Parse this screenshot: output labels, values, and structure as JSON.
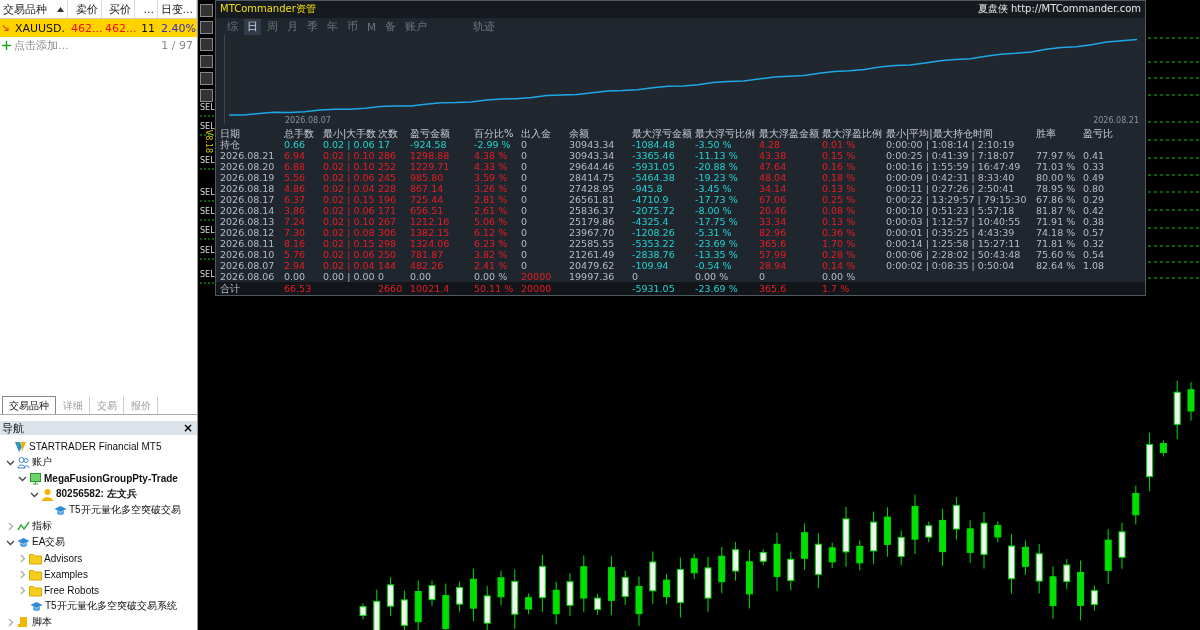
{
  "market_watch": {
    "columns": [
      "交易品种",
      "卖价",
      "买价",
      "...",
      "日变..."
    ],
    "rows": [
      {
        "selected": true,
        "cells": [
          "XAUUSD.",
          "462...",
          "462...",
          "11",
          "2.40%"
        ]
      }
    ],
    "add_label": "点击添加...",
    "count": "1 / 97"
  },
  "bottom_tabs": [
    {
      "label": "交易品种",
      "selected": true
    },
    {
      "label": "详细",
      "selected": false
    },
    {
      "label": "交易",
      "selected": false
    },
    {
      "label": "报价",
      "selected": false
    }
  ],
  "navigator": {
    "title": "导航",
    "close": "×",
    "tree": [
      {
        "label": "STARTRADER Financial MT5",
        "kind": "broker",
        "bold": false,
        "children": [
          {
            "label": "账户",
            "kind": "accounts",
            "bold": false,
            "expanded": true,
            "children": [
              {
                "label": "MegaFusionGroupPty-Trade",
                "kind": "server",
                "bold": true,
                "expanded": true,
                "children": [
                  {
                    "label": "80256582: 左文兵",
                    "kind": "user",
                    "bold": true,
                    "expanded": true,
                    "children": [
                      {
                        "label": "T5开元量化多空突破交易",
                        "kind": "ea",
                        "bold": false
                      }
                    ]
                  }
                ]
              }
            ]
          },
          {
            "label": "指标",
            "kind": "indicator",
            "bold": false,
            "expanded": false
          },
          {
            "label": "EA交易",
            "kind": "ea",
            "bold": false,
            "expanded": true,
            "children": [
              {
                "label": "Advisors",
                "kind": "folder",
                "bold": false,
                "expanded": false
              },
              {
                "label": "Examples",
                "kind": "folder",
                "bold": false,
                "expanded": false
              },
              {
                "label": "Free Robots",
                "kind": "folder",
                "bold": false,
                "expanded": false
              },
              {
                "label": "T5开元量化多空突破交易系统",
                "kind": "ea",
                "bold": false
              }
            ]
          },
          {
            "label": "脚本",
            "kind": "script",
            "bold": false,
            "expanded": false
          }
        ]
      }
    ]
  },
  "chart_side": {
    "version": "V8.18",
    "labels": [
      "SEL",
      "SEL",
      "SEL",
      "SEL",
      "SEL",
      "SEL",
      "SEL",
      "SEL"
    ]
  },
  "panel": {
    "title": "MTCommander资管",
    "brand": "夏盘侠 http://MTCommander.com",
    "tab_groups": [
      [
        {
          "label": "综",
          "selected": false
        },
        {
          "label": "日",
          "selected": true
        },
        {
          "label": "周",
          "selected": false
        },
        {
          "label": "月",
          "selected": false
        },
        {
          "label": "季",
          "selected": false
        },
        {
          "label": "年",
          "selected": false
        },
        {
          "label": "币",
          "selected": false
        },
        {
          "label": "M",
          "selected": false
        },
        {
          "label": "备",
          "selected": false
        },
        {
          "label": "账户",
          "selected": false
        }
      ],
      [
        {
          "label": "轨迹",
          "selected": false
        }
      ]
    ],
    "curve": {
      "start_date": "2026.08.07",
      "end_date": "2026.08.21"
    },
    "table": {
      "columns": [
        "日期",
        "总手数",
        "最小|大手数",
        "次数",
        "盈亏金额",
        "百分比%",
        "出入金",
        "余额",
        "最大浮亏金额",
        "最大浮亏比例",
        "最大浮盈金额",
        "最大浮盈比例",
        "最小|平均|最大持仓时间",
        "胜率",
        "盈亏比"
      ],
      "rows": [
        {
          "kind": "position",
          "cells": [
            "持仓",
            "0.66",
            "0.02 | 0.06",
            "17",
            "-924.58",
            "-2.99 %",
            "0",
            "30943.34",
            "-1084.48",
            "-3.50 %",
            "4.28",
            "0.01 %",
            "0:00:00 | 1:08:14 | 2:10:19",
            null,
            null
          ]
        },
        {
          "kind": "day",
          "cells": [
            "2026.08.21",
            "6.94",
            "0.02 | 0.10",
            "286",
            "1298.88",
            "4.38 %",
            "0",
            "30943.34",
            "-3365.46",
            "-11.13 %",
            "43.38",
            "0.15 %",
            "0:00:25 | 0:41:39 | 7:18:07",
            "77.97 %",
            "0.41"
          ]
        },
        {
          "kind": "day",
          "cells": [
            "2026.08.20",
            "6.88",
            "0.02 | 0.10",
            "252",
            "1229.71",
            "4.33 %",
            "0",
            "29644.46",
            "-5931.05",
            "-20.88 %",
            "47.64",
            "0.16 %",
            "0:00:16 | 1:55:59 | 16:47:49",
            "71.03 %",
            "0.33"
          ]
        },
        {
          "kind": "day",
          "cells": [
            "2026.08.19",
            "5.56",
            "0.02 | 0.06",
            "245",
            "985.80",
            "3.59 %",
            "0",
            "28414.75",
            "-5464.38",
            "-19.23 %",
            "48.04",
            "0.18 %",
            "0:00:09 | 0:42:31 | 8:33:40",
            "80.00 %",
            "0.49"
          ]
        },
        {
          "kind": "day",
          "cells": [
            "2026.08.18",
            "4.86",
            "0.02 | 0.04",
            "228",
            "867.14",
            "3.26 %",
            "0",
            "27428.95",
            "-945.8",
            "-3.45 %",
            "34.14",
            "0.13 %",
            "0:00:11 | 0:27:26 | 2:50:41",
            "78.95 %",
            "0.80"
          ]
        },
        {
          "kind": "day",
          "cells": [
            "2026.08.17",
            "6.37",
            "0.02 | 0.15",
            "196",
            "725.44",
            "2.81 %",
            "0",
            "26561.81",
            "-4710.9",
            "-17.73 %",
            "67.06",
            "0.25 %",
            "0:00:22 | 13:29:57 | 79:15:30",
            "67.86 %",
            "0.29"
          ]
        },
        {
          "kind": "day",
          "cells": [
            "2026.08.14",
            "3.86",
            "0.02 | 0.06",
            "171",
            "656.51",
            "2.61 %",
            "0",
            "25836.37",
            "-2075.72",
            "-8.00 %",
            "20.46",
            "0.08 %",
            "0:00:10 | 0:51:23 | 5:57:18",
            "81.87 %",
            "0.42"
          ]
        },
        {
          "kind": "day",
          "cells": [
            "2026.08.13",
            "7.24",
            "0.02 | 0.10",
            "267",
            "1212.16",
            "5.06 %",
            "0",
            "25179.86",
            "-4325.4",
            "-17.75 %",
            "33.34",
            "0.13 %",
            "0:00:03 | 1:12:57 | 10:40:55",
            "71.91 %",
            "0.38"
          ]
        },
        {
          "kind": "day",
          "cells": [
            "2026.08.12",
            "7.30",
            "0.02 | 0.08",
            "306",
            "1382.15",
            "6.12 %",
            "0",
            "23967.70",
            "-1208.26",
            "-5.31 %",
            "82.96",
            "0.36 %",
            "0:00:01 | 0:35:25 | 4:43:39",
            "74.18 %",
            "0.57"
          ]
        },
        {
          "kind": "day",
          "cells": [
            "2026.08.11",
            "8.16",
            "0.02 | 0.15",
            "298",
            "1324.06",
            "6.23 %",
            "0",
            "22585.55",
            "-5353.22",
            "-23.69 %",
            "365.6",
            "1.70 %",
            "0:00:14 | 1:25:58 | 15:27:11",
            "71.81 %",
            "0.32"
          ]
        },
        {
          "kind": "day",
          "cells": [
            "2026.08.10",
            "5.76",
            "0.02 | 0.06",
            "250",
            "781.87",
            "3.82 %",
            "0",
            "21261.49",
            "-2838.76",
            "-13.35 %",
            "57.99",
            "0.28 %",
            "0:00:06 | 2:28:02 | 50:43:48",
            "75.60 %",
            "0.54"
          ]
        },
        {
          "kind": "day",
          "cells": [
            "2026.08.07",
            "2.94",
            "0.02 | 0.04",
            "144",
            "482.26",
            "2.41 %",
            "0",
            "20479.62",
            "-109.94",
            "-0.54 %",
            "28.94",
            "0.14 %",
            "0:00:02 | 0:08:35 | 0:50:04",
            "82.64 %",
            "1.08"
          ]
        },
        {
          "kind": "flat",
          "cells": [
            "2026.08.06",
            "0.00",
            "0.00 | 0.00",
            "0",
            "0.00",
            "0.00 %",
            "20000",
            "19997.36",
            "0",
            "0.00 %",
            "0",
            "0.00 %",
            null,
            null,
            null
          ]
        },
        {
          "kind": "total",
          "cells": [
            "合计",
            "66.53",
            null,
            "2660",
            "10021.4",
            "50.11 %",
            "20000",
            null,
            "-5931.05",
            "-23.69 %",
            "365.6",
            "1.7 %",
            null,
            null,
            null
          ]
        }
      ]
    }
  }
}
